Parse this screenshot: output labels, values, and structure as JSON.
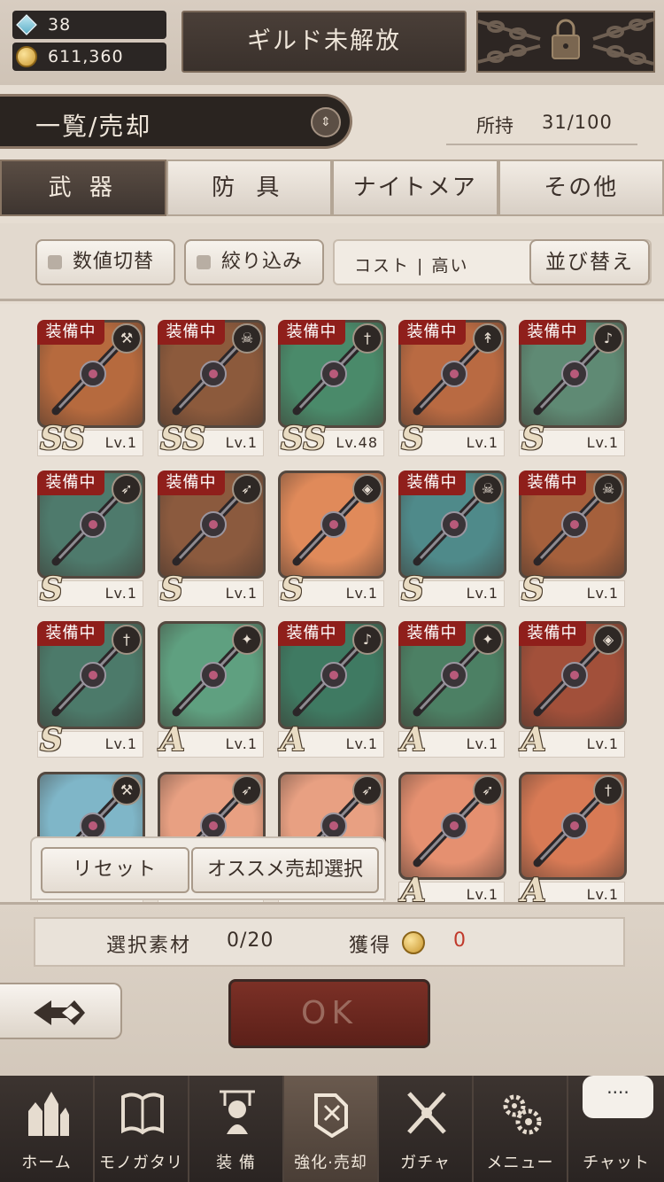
{
  "resources": {
    "gems": "38",
    "gold": "611,360"
  },
  "guild_button": "ギルド未解放",
  "list_title": "一覧/売却",
  "owned": {
    "label": "所持",
    "count": "31/100"
  },
  "tabs": [
    "武 器",
    "防 具",
    "ナイトメア",
    "その他"
  ],
  "filters": {
    "toggle_values": "数値切替",
    "narrow": "絞り込み",
    "sort_current": "コスト | 高い",
    "sort_button": "並び替え"
  },
  "equipped_label": "装備中",
  "cards": [
    {
      "rank": "SS",
      "lv": "Lv.1",
      "equipped": true,
      "type": "hammer-icon",
      "color": "#b66a3e"
    },
    {
      "rank": "SS",
      "lv": "Lv.1",
      "equipped": true,
      "type": "tome-icon",
      "color": "#8c5a3c"
    },
    {
      "rank": "SS",
      "lv": "Lv.48",
      "equipped": true,
      "type": "sword-icon",
      "color": "#4a8a6a"
    },
    {
      "rank": "S",
      "lv": "Lv.1",
      "equipped": true,
      "type": "spear-icon",
      "color": "#b96a42"
    },
    {
      "rank": "S",
      "lv": "Lv.1",
      "equipped": true,
      "type": "harp-icon",
      "color": "#5f8a74"
    },
    {
      "rank": "S",
      "lv": "Lv.1",
      "equipped": true,
      "type": "bow-icon",
      "color": "#4e7a6c"
    },
    {
      "rank": "S",
      "lv": "Lv.1",
      "equipped": true,
      "type": "bow-icon",
      "color": "#8b5a3e"
    },
    {
      "rank": "S",
      "lv": "Lv.1",
      "equipped": false,
      "type": "shield-icon",
      "color": "#e08a5a"
    },
    {
      "rank": "S",
      "lv": "Lv.1",
      "equipped": true,
      "type": "tome-icon",
      "color": "#4f8a8a"
    },
    {
      "rank": "S",
      "lv": "Lv.1",
      "equipped": true,
      "type": "tome-icon",
      "color": "#a5603c"
    },
    {
      "rank": "S",
      "lv": "Lv.1",
      "equipped": true,
      "type": "sword-icon",
      "color": "#4c7a6a"
    },
    {
      "rank": "A",
      "lv": "Lv.1",
      "equipped": false,
      "type": "staff-icon",
      "color": "#5fa080"
    },
    {
      "rank": "A",
      "lv": "Lv.1",
      "equipped": true,
      "type": "harp-icon",
      "color": "#3f7a62"
    },
    {
      "rank": "A",
      "lv": "Lv.1",
      "equipped": true,
      "type": "staff-icon",
      "color": "#4c8064"
    },
    {
      "rank": "A",
      "lv": "Lv.1",
      "equipped": true,
      "type": "shield-icon",
      "color": "#a2503a"
    },
    {
      "rank": "",
      "lv": "",
      "equipped": false,
      "type": "hammer-icon",
      "color": "#7fb6c8"
    },
    {
      "rank": "",
      "lv": "",
      "equipped": false,
      "type": "bow-icon",
      "color": "#e8a082"
    },
    {
      "rank": "",
      "lv": "",
      "equipped": false,
      "type": "bow-icon",
      "color": "#e8a082"
    },
    {
      "rank": "A",
      "lv": "Lv.1",
      "equipped": false,
      "type": "bow-icon",
      "color": "#e59070"
    },
    {
      "rank": "A",
      "lv": "Lv.1",
      "equipped": false,
      "type": "sword-icon",
      "color": "#d87a55"
    }
  ],
  "floating": {
    "reset": "リセット",
    "recommend": "オススメ売却選択"
  },
  "summary": {
    "material_label": "選択素材",
    "material_count": "0/20",
    "gain_label": "獲得",
    "gain_value": "0"
  },
  "ok_button": "OK",
  "nav": [
    "ホーム",
    "モノガタリ",
    "装 備",
    "強化·売却",
    "ガチャ",
    "メニュー",
    "チャット"
  ],
  "chat_bubble": "····"
}
